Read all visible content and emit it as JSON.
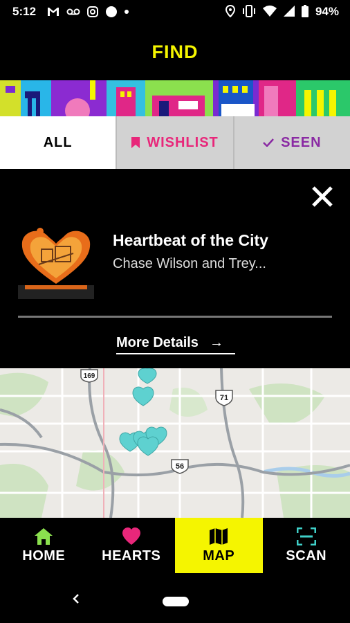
{
  "status": {
    "time": "5:12",
    "battery": "94%"
  },
  "header": {
    "title": "FIND"
  },
  "tabs": {
    "all": "ALL",
    "wishlist": "WISHLIST",
    "seen": "SEEN"
  },
  "card": {
    "title": "Heartbeat of the City",
    "artist": "Chase Wilson and Trey...",
    "more_details": "More Details",
    "arrow": "→"
  },
  "map": {
    "route_169": "169",
    "route_71": "71",
    "route_56": "56"
  },
  "nav": {
    "home": "HOME",
    "hearts": "HEARTS",
    "map": "MAP",
    "scan": "SCAN"
  },
  "colors": {
    "accent_yellow": "#f5f500",
    "wishlist_pink": "#e8277a",
    "seen_purple": "#8a2aa3",
    "home_green": "#8be04e",
    "scan_teal": "#3fd0c9",
    "heart_marker": "#5ed1d0"
  }
}
